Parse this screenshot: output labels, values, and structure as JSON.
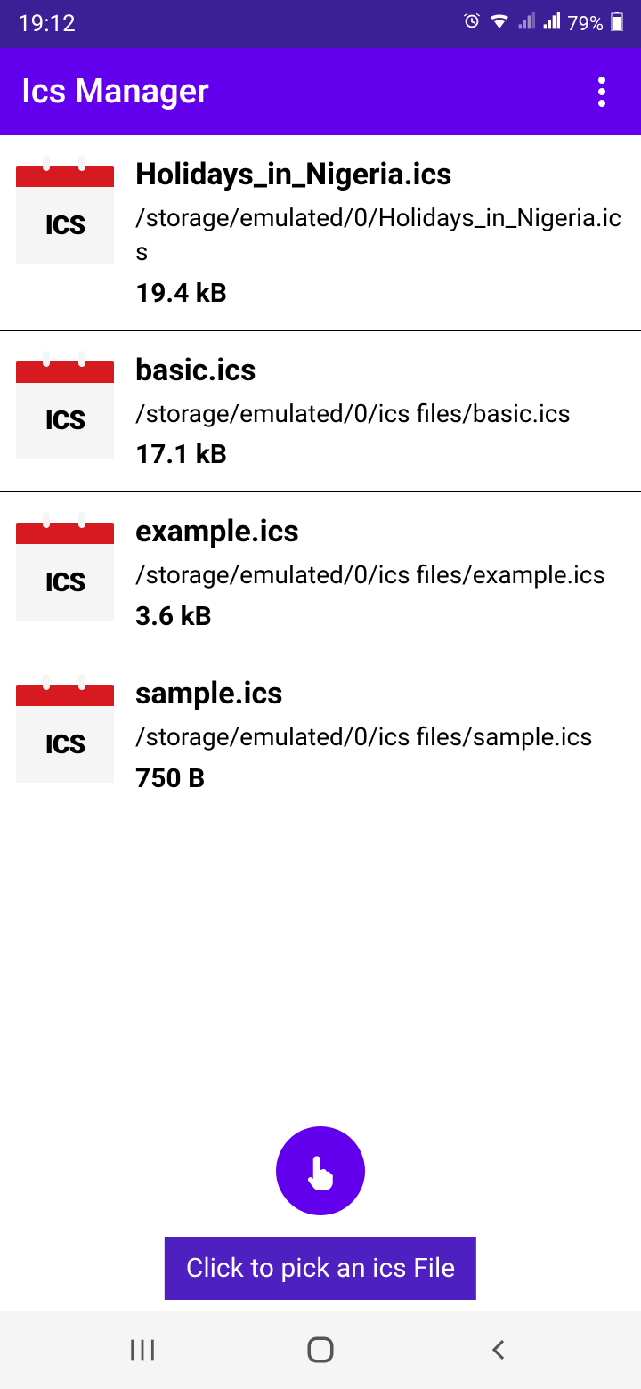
{
  "status_bar": {
    "time": "19:12",
    "battery": "79%"
  },
  "app_bar": {
    "title": "Ics Manager"
  },
  "files": [
    {
      "name": "Holidays_in_Nigeria.ics",
      "path": "/storage/emulated/0/Holidays_in_Nigeria.ics",
      "size": "19.4 kB",
      "icon_label": "ICS"
    },
    {
      "name": "basic.ics",
      "path": "/storage/emulated/0/ics files/basic.ics",
      "size": "17.1 kB",
      "icon_label": "ICS"
    },
    {
      "name": "example.ics",
      "path": "/storage/emulated/0/ics files/example.ics",
      "size": "3.6 kB",
      "icon_label": "ICS"
    },
    {
      "name": "sample.ics",
      "path": "/storage/emulated/0/ics files/sample.ics",
      "size": "750 B",
      "icon_label": "ICS"
    }
  ],
  "fab_hint": "Click to pick an ics File"
}
